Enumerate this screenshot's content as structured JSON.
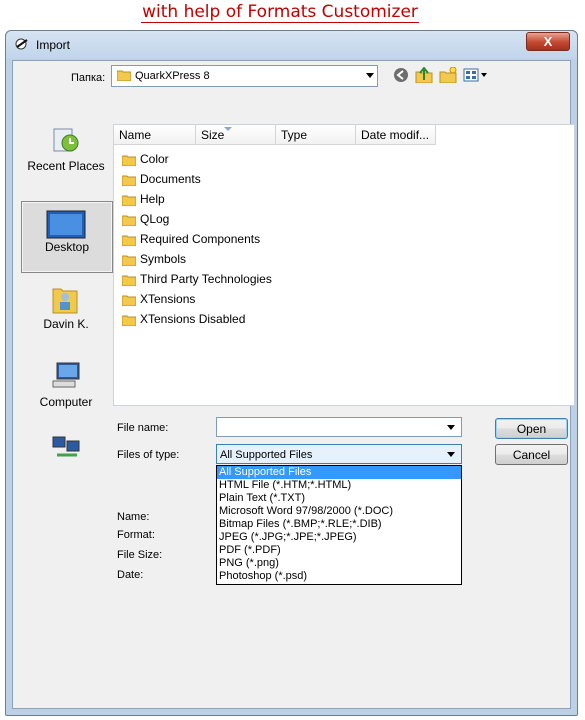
{
  "caption": "with help of Formats Customizer",
  "window": {
    "title": "Import",
    "close_label": "X"
  },
  "lookin": {
    "label": "Папка:",
    "value": "QuarkXPress 8"
  },
  "toolbar_icons": [
    "back-icon",
    "up-folder-icon",
    "new-folder-icon",
    "view-menu-icon"
  ],
  "places": [
    {
      "label": "Recent Places",
      "icon": "recent-places-icon"
    },
    {
      "label": "Desktop",
      "icon": "desktop-icon"
    },
    {
      "label": "Davin K.",
      "icon": "user-folder-icon"
    },
    {
      "label": "Computer",
      "icon": "computer-icon"
    },
    {
      "label": "",
      "icon": "network-icon"
    }
  ],
  "columns": [
    "Name",
    "Size",
    "Type",
    "Date modif..."
  ],
  "files": [
    "Color",
    "Documents",
    "Help",
    "QLog",
    "Required Components",
    "Symbols",
    "Third Party Technologies",
    "XTensions",
    "XTensions Disabled"
  ],
  "filename": {
    "label": "File name:",
    "value": ""
  },
  "filetype": {
    "label": "Files of type:",
    "value": "All Supported Files",
    "options": [
      "All Supported Files",
      "HTML File (*.HTM;*.HTML)",
      "Plain Text (*.TXT)",
      "Microsoft Word 97/98/2000 (*.DOC)",
      "Bitmap Files (*.BMP;*.RLE;*.DIB)",
      "JPEG (*.JPG;*.JPE;*.JPEG)",
      "PDF (*.PDF)",
      "PNG (*.png)",
      "Photoshop (*.psd)"
    ]
  },
  "buttons": {
    "open": "Open",
    "cancel": "Cancel"
  },
  "info_labels": {
    "name": "Name:",
    "format": "Format:",
    "size": "File Size:",
    "date": "Date:"
  },
  "colors": {
    "selection": "#3399ff",
    "caption": "#c00000",
    "folder": "#f2c94c"
  }
}
